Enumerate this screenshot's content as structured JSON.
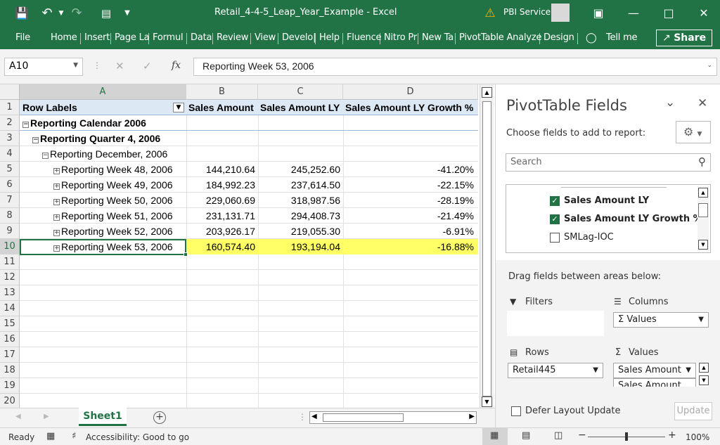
{
  "titlebar": {
    "document_title": "Retail_4-4-5_Leap_Year_Example  -  Excel",
    "service": "PBI Service"
  },
  "ribbon": {
    "tabs": [
      "File",
      "Home",
      "Insert",
      "Page La",
      "Formul",
      "Data",
      "Review",
      "View",
      "Develo|",
      "Help",
      "Fluence",
      "Nitro Pr",
      "New Ta",
      "PivotTable Analyze",
      "Design"
    ],
    "tell_me": "Tell me",
    "share": "Share"
  },
  "formula_bar": {
    "name_box": "A10",
    "formula": "Reporting Week 53, 2006",
    "fx": "fx"
  },
  "grid": {
    "columns": [
      "A",
      "B",
      "C",
      "D"
    ],
    "row_numbers": [
      "1",
      "2",
      "3",
      "4",
      "5",
      "6",
      "7",
      "8",
      "9",
      "10",
      "11",
      "12",
      "13",
      "14",
      "15",
      "16",
      "17",
      "18",
      "19",
      "20"
    ],
    "header": {
      "row_labels": "Row Labels",
      "sales_amount": "Sales Amount",
      "sales_amount_ly": "Sales Amount LY",
      "growth": "Sales Amount LY Growth %"
    },
    "calendar": "Reporting Calendar 2006",
    "quarter": "Reporting Quarter 4, 2006",
    "month": "Reporting December, 2006",
    "weeks": [
      {
        "label": "Reporting Week 48, 2006",
        "sales": "144,210.64",
        "ly": "245,252.60",
        "growth": "-41.20%"
      },
      {
        "label": "Reporting Week 49, 2006",
        "sales": "184,992.23",
        "ly": "237,614.50",
        "growth": "-22.15%"
      },
      {
        "label": "Reporting Week 50, 2006",
        "sales": "229,060.69",
        "ly": "318,987.56",
        "growth": "-28.19%"
      },
      {
        "label": "Reporting Week 51, 2006",
        "sales": "231,131.71",
        "ly": "294,408.73",
        "growth": "-21.49%"
      },
      {
        "label": "Reporting Week 52, 2006",
        "sales": "203,926.17",
        "ly": "219,055.30",
        "growth": "-6.91%"
      },
      {
        "label": "Reporting Week 53, 2006",
        "sales": "160,574.40",
        "ly": "193,194.04",
        "growth": "-16.88%"
      }
    ],
    "highlight_color": "#ffff66"
  },
  "sheets": {
    "active": "Sheet1"
  },
  "status": {
    "ready": "Ready",
    "accessibility": "Accessibility: Good to go",
    "zoom": "100%"
  },
  "pane": {
    "title": "PivotTable Fields",
    "subtitle": "Choose fields to add to report:",
    "search_placeholder": "Search",
    "fields": [
      {
        "label": "Sales Amount LY",
        "checked": true
      },
      {
        "label": "Sales Amount LY Growth %",
        "checked": true
      },
      {
        "label": "SMLag-IOC",
        "checked": false
      }
    ],
    "drag_label": "Drag fields between areas below:",
    "filters": "Filters",
    "columns": "Columns",
    "columns_value": "Values",
    "rows": "Rows",
    "rows_value": "Retail445",
    "values": "Values",
    "values_item1": "Sales Amount",
    "values_item2": "Sales Amount",
    "defer": "Defer Layout Update",
    "update": "Update"
  }
}
